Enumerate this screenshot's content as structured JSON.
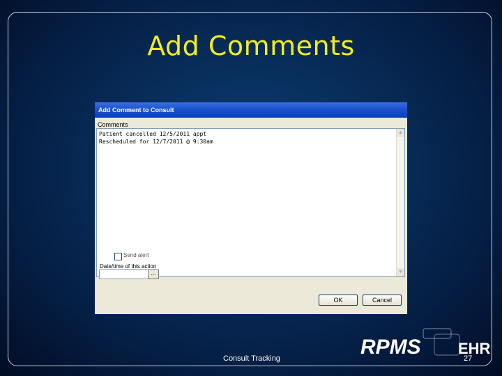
{
  "slide": {
    "title": "Add Comments",
    "footer": "Consult Tracking",
    "page_number": "27"
  },
  "dialog": {
    "title": "Add Comment to Consult",
    "comments_label": "Comments",
    "comment_lines": [
      "Patient cancelled 12/5/2011 appt",
      "Rescheduled for 12/7/2011 @ 9:30am"
    ],
    "send_alert_label": "Send alert",
    "send_alert_checked": false,
    "datetime_label": "Date/time of this action",
    "datetime_value": "",
    "ellipsis_label": "...",
    "ok_label": "OK",
    "cancel_label": "Cancel"
  },
  "logo": {
    "text_left": "RPMS",
    "text_right": "EHR"
  },
  "colors": {
    "title_yellow": "#f2ee1d",
    "background_blue": "#072a55",
    "titlebar_blue": "#1d55d0"
  }
}
